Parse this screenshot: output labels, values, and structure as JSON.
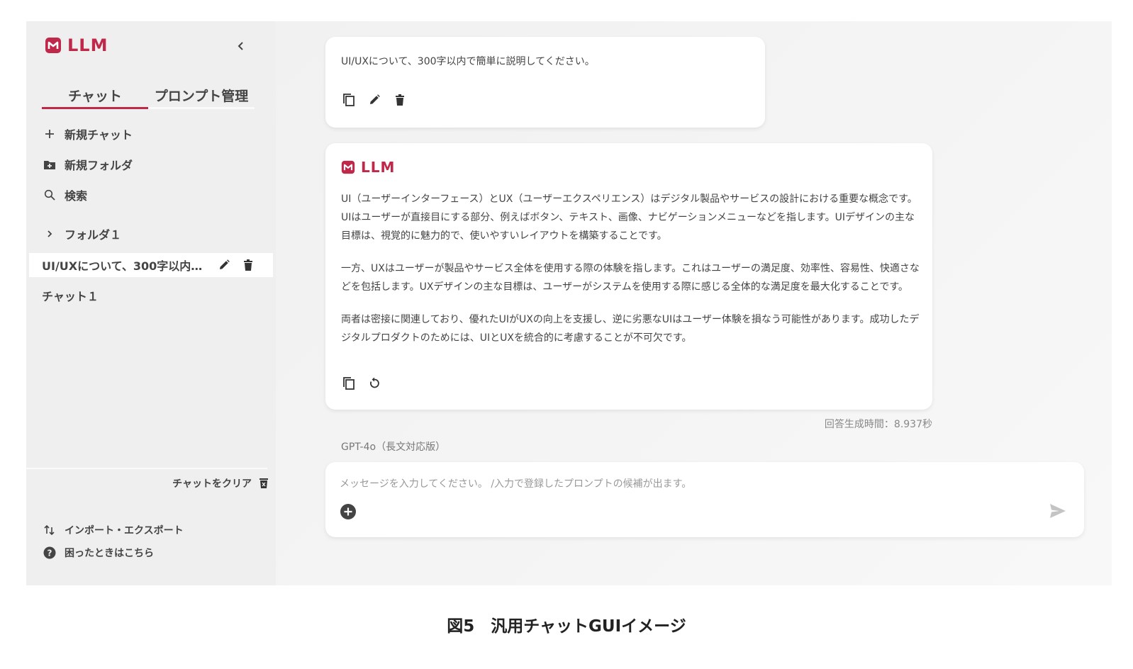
{
  "colors": {
    "accent": "#c0284a",
    "sidebar_bg": "#efefef",
    "card_bg": "#ffffff",
    "icon": "#333333"
  },
  "sidebar": {
    "brand": "LLM",
    "collapse_icon": "chevron-left-icon",
    "tabs": [
      {
        "label": "チャット",
        "active": true
      },
      {
        "label": "プロンプト管理",
        "active": false
      }
    ],
    "menu": [
      {
        "label": "新規チャット",
        "icon": "plus-icon"
      },
      {
        "label": "新規フォルダ",
        "icon": "folder-plus-icon"
      },
      {
        "label": "検索",
        "icon": "search-icon"
      }
    ],
    "folder": {
      "label": "フォルダ１",
      "icon": "chevron-right-icon"
    },
    "chats": [
      {
        "title": "UI/UXについて、300字以内で簡単に説明してください。",
        "selected": true
      },
      {
        "title": "チャット１",
        "selected": false
      }
    ],
    "clear_label": "チャットをクリア",
    "import_export_label": "インポート・エクスポート",
    "help_label": "困ったときはこちら"
  },
  "conversation": {
    "user_message": "UI/UXについて、300字以内で簡単に説明してください。",
    "ai_brand": "LLM",
    "ai_paragraphs": [
      "UI（ユーザーインターフェース）とUX（ユーザーエクスペリエンス）はデジタル製品やサービスの設計における重要な概念です。UIはユーザーが直接目にする部分、例えばボタン、テキスト、画像、ナビゲーションメニューなどを指します。UIデザインの主な目標は、視覚的に魅力的で、使いやすいレイアウトを構築することです。",
      "一方、UXはユーザーが製品やサービス全体を使用する際の体験を指します。これはユーザーの満足度、効率性、容易性、快適さなどを包括します。UXデザインの主な目標は、ユーザーがシステムを使用する際に感じる全体的な満足度を最大化することです。",
      "両者は密接に関連しており、優れたUIがUXの向上を支援し、逆に劣悪なUIはユーザー体験を損なう可能性があります。成功したデジタルプロダクトのためには、UIとUXを統合的に考慮することが不可欠です。"
    ],
    "generation_time": "回答生成時間：8.937秒",
    "model": "GPT-4o（長文対応版）"
  },
  "input": {
    "placeholder": "メッセージを入力してください。 /入力で登録したプロンプトの候補が出ます。",
    "value": ""
  },
  "caption": "図5　汎用チャットGUIイメージ"
}
